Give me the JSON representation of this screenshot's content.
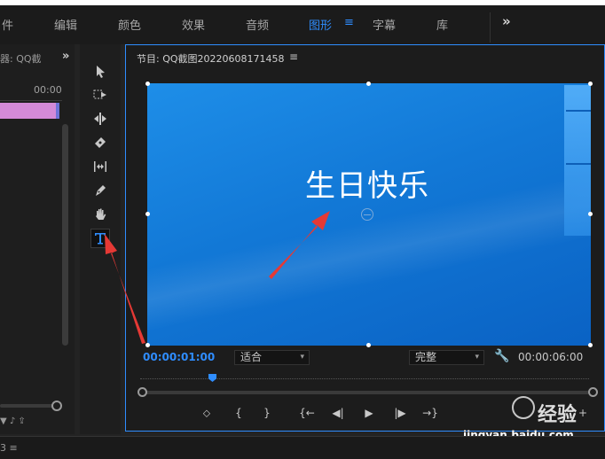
{
  "topbar": {
    "tabs": [
      "件",
      "编辑",
      "颜色",
      "效果",
      "音频",
      "图形",
      "字幕",
      "库"
    ],
    "active_tab": "图形",
    "menu_glyph": "≡",
    "overflow": "»"
  },
  "left_panel": {
    "title": "器: QQ截",
    "overflow": "»",
    "timecode": "00:00",
    "footer_icons": "▼ ♪ ⇪"
  },
  "tools": [
    {
      "name": "selection-tool",
      "icon": "arrow-pointer"
    },
    {
      "name": "track-select-tool",
      "icon": "track-select"
    },
    {
      "name": "ripple-edit-tool",
      "icon": "ripple-edit"
    },
    {
      "name": "razor-tool",
      "icon": "razor"
    },
    {
      "name": "slip-tool",
      "icon": "slip"
    },
    {
      "name": "pen-tool",
      "icon": "pen"
    },
    {
      "name": "hand-tool",
      "icon": "hand"
    },
    {
      "name": "type-tool",
      "icon": "type",
      "active": true
    }
  ],
  "monitor": {
    "title": "节目: QQ截图20220608171458",
    "menu_glyph": "≡",
    "caption": "生日快乐",
    "timecode_current": "00:00:01:00",
    "timecode_duration": "00:00:06:00",
    "zoom_select": "适合",
    "quality_select": "完整"
  },
  "controls": {
    "marker": "⬦",
    "mark_in": "{",
    "mark_out": "}",
    "go_in": "{←",
    "step_back": "◀|",
    "play": "▶",
    "step_forward": "|▶",
    "go_out": "→}",
    "add": "+"
  },
  "watermark": {
    "text": "经验",
    "url": "jingyan.baidu.com"
  },
  "bottom_bar": {
    "text": "3 ≡"
  },
  "colors": {
    "accent": "#2f8dff",
    "annotation_arrow": "#e53935"
  }
}
